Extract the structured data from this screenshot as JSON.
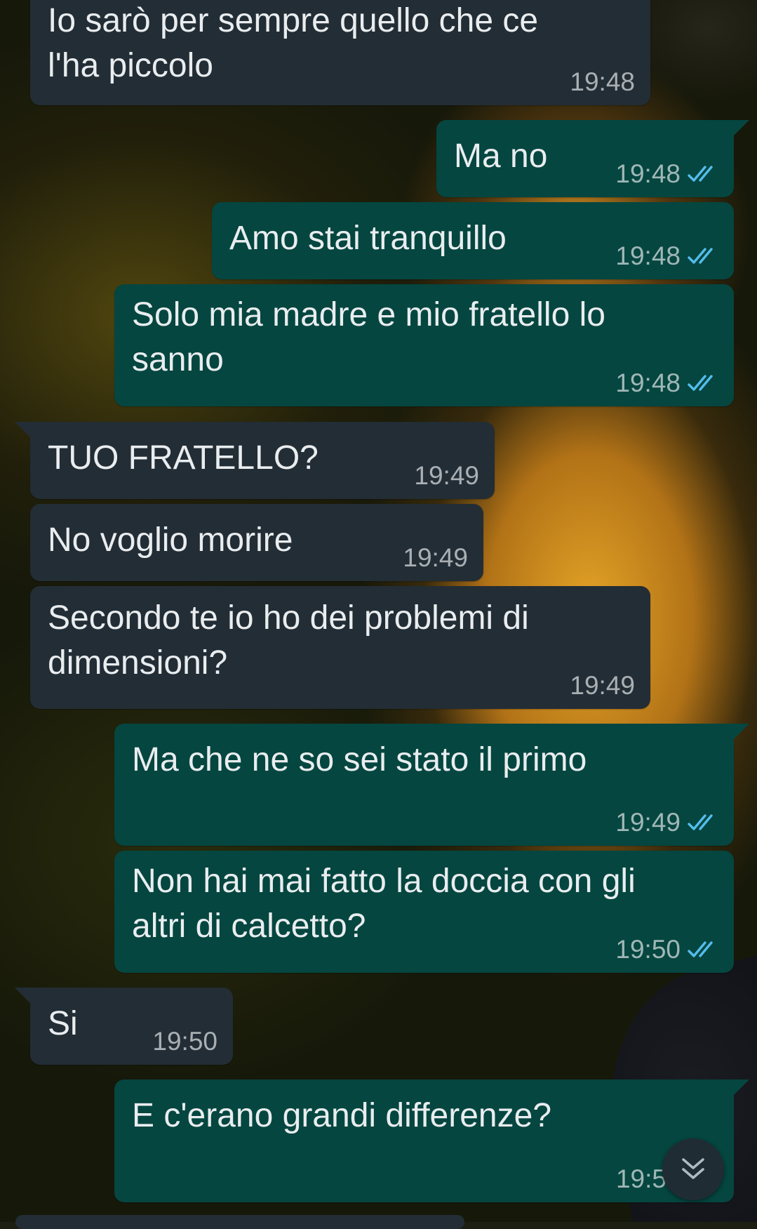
{
  "colors": {
    "incoming_bubble": "#232d35",
    "outgoing_bubble": "#054640",
    "message_text": "#e9edef",
    "read_ticks": "#53bdeb"
  },
  "messages": [
    {
      "direction": "in",
      "text": "Io sarò per sempre quello che ce\nl'ha piccolo",
      "time": "19:48"
    },
    {
      "direction": "out",
      "text": "Ma no",
      "time": "19:48",
      "status": "read-double-check-icon"
    },
    {
      "direction": "out",
      "text": "Amo stai tranquillo",
      "time": "19:48",
      "status": "read-double-check-icon"
    },
    {
      "direction": "out",
      "text": "Solo mia madre e mio fratello lo\nsanno",
      "time": "19:48",
      "status": "read-double-check-icon"
    },
    {
      "direction": "in",
      "text": "TUO FRATELLO?",
      "time": "19:49"
    },
    {
      "direction": "in",
      "text": "No voglio morire",
      "time": "19:49"
    },
    {
      "direction": "in",
      "text": "Secondo te io ho dei problemi di\ndimensioni?",
      "time": "19:49"
    },
    {
      "direction": "out",
      "text": "Ma che ne so sei stato il primo",
      "time": "19:49",
      "status": "read-double-check-icon"
    },
    {
      "direction": "out",
      "text": "Non hai mai fatto la doccia con gli\naltri di calcetto?",
      "time": "19:50",
      "status": "read-double-check-icon"
    },
    {
      "direction": "in",
      "text": "Si",
      "time": "19:50"
    },
    {
      "direction": "out",
      "text": "E c'erano grandi differenze?",
      "time": "19:5",
      "status": "read-double-check-icon"
    }
  ],
  "scroll_button": {
    "icon": "double-chevron-down-icon"
  }
}
